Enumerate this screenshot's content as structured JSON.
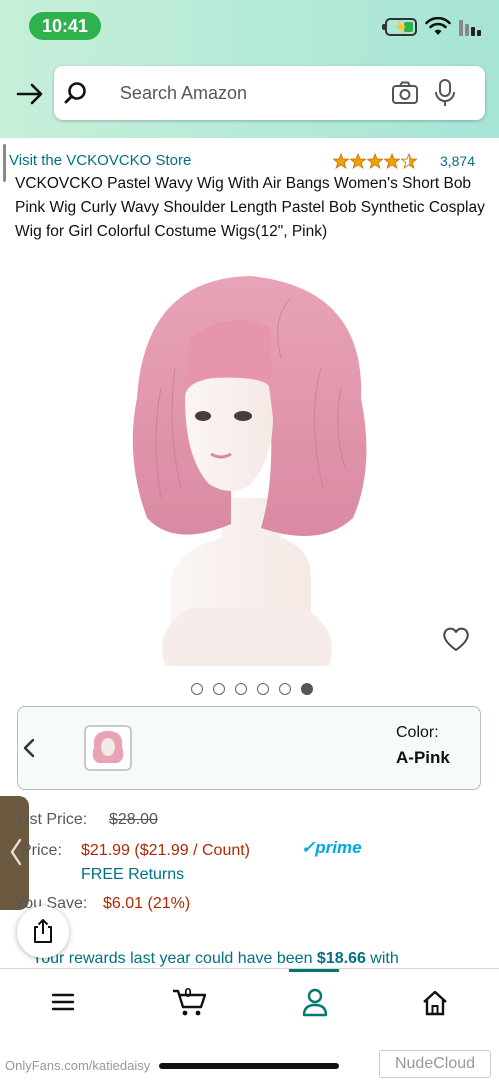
{
  "status_bar": {
    "time": "10:41",
    "icons": [
      "battery-charging-icon",
      "wifi-icon",
      "cellular-signal-icon"
    ]
  },
  "search": {
    "placeholder": "Search Amazon",
    "icons": [
      "search-icon",
      "camera-icon",
      "microphone-icon",
      "back-arrow-icon"
    ]
  },
  "product": {
    "store_link": "Visit the VCKOVCKO Store",
    "rating_stars": 4.5,
    "rating_count": "3,874",
    "title": "VCKOVCKO Pastel Wavy Wig With Air Bangs Women's Short Bob Pink Wig Curly Wavy Shoulder Length Pastel Bob Synthetic Cosplay Wig for Girl Colorful Costume Wigs(12\", Pink)",
    "image_count": 6,
    "active_image_index": 5
  },
  "color_selector": {
    "label": "Color:",
    "value": "A-Pink"
  },
  "pricing": {
    "list_price_label": "List Price:",
    "list_price_value": "$28.00",
    "price_label": "Price:",
    "price_value": "$21.99 ($21.99 / Count)",
    "prime_label": "✓prime",
    "free_returns": "FREE Returns",
    "you_save_label": "You Save:",
    "you_save_value": "$6.01 (21%)"
  },
  "rewards": {
    "text_before": "Your rewards last year could have been ",
    "amount": "$18.66",
    "text_after": " with"
  },
  "bottom_nav": {
    "items": [
      "home-icon",
      "account-icon",
      "cart-icon",
      "menu-icon"
    ],
    "cart_count": "0"
  },
  "watermarks": {
    "left": "OnlyFans.com/katiedaisy",
    "right": "NudeCloud"
  },
  "colors": {
    "header_gradient_start": "#a6e4d6",
    "link": "#007185",
    "price": "#b12704",
    "prime": "#00a8e1",
    "time_pill": "#2fb24d"
  }
}
